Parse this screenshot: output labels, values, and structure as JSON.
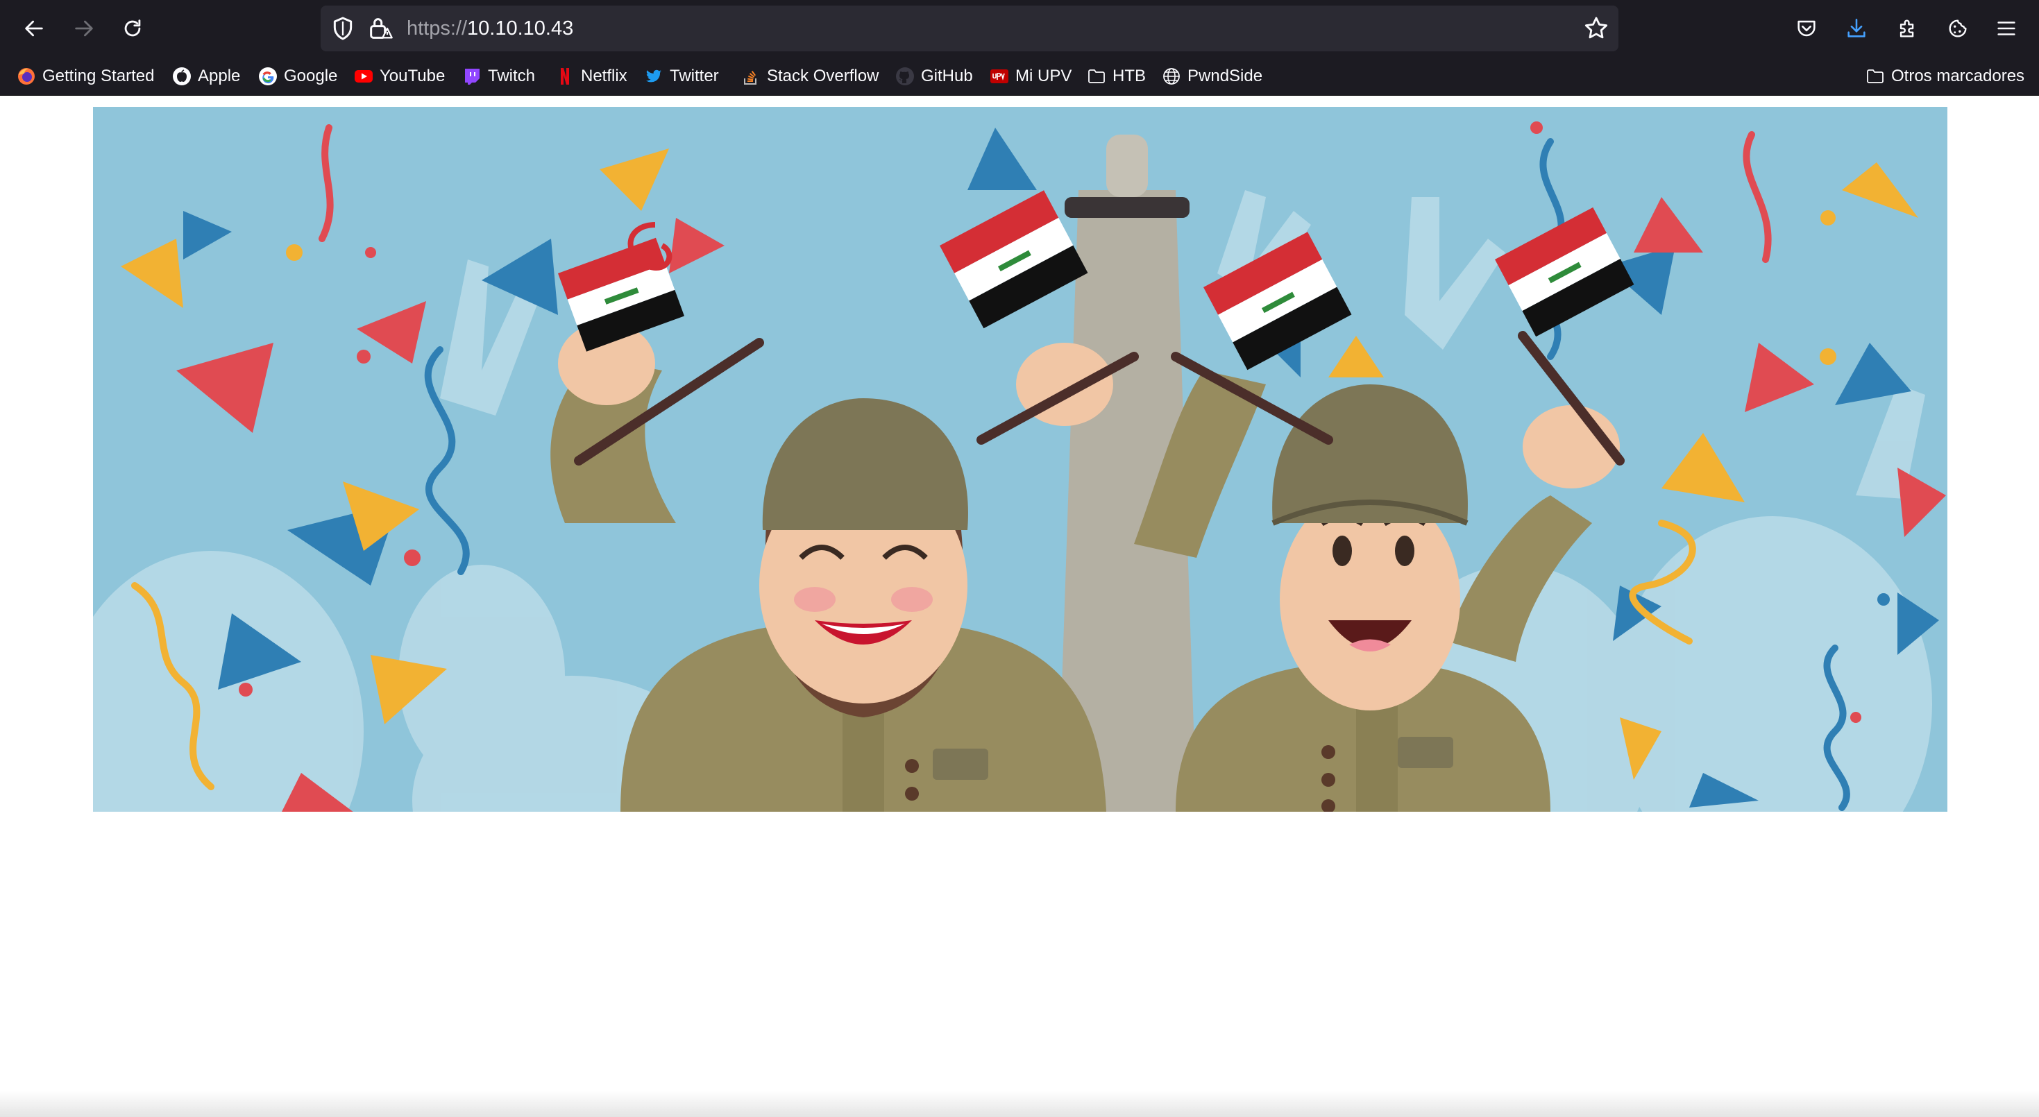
{
  "browser": {
    "url_scheme": "https://",
    "url_host": "10.10.10.43",
    "accent_color": "#1c1b22",
    "icons": {
      "back": "arrow-left-icon",
      "forward": "arrow-right-icon",
      "reload": "reload-icon",
      "tracking_protection": "shield-icon",
      "connection": "lock-warning-icon",
      "bookmark_page": "star-icon",
      "pocket": "pocket-icon",
      "downloads": "download-icon",
      "extensions": "puzzle-icon",
      "cookies": "cookie-icon",
      "menu": "hamburger-menu-icon"
    }
  },
  "bookmarks": [
    {
      "label": "Getting Started",
      "icon": "firefox-icon"
    },
    {
      "label": "Apple",
      "icon": "apple-icon"
    },
    {
      "label": "Google",
      "icon": "google-icon"
    },
    {
      "label": "YouTube",
      "icon": "youtube-icon"
    },
    {
      "label": "Twitch",
      "icon": "twitch-icon"
    },
    {
      "label": "Netflix",
      "icon": "netflix-icon"
    },
    {
      "label": "Twitter",
      "icon": "twitter-icon"
    },
    {
      "label": "Stack Overflow",
      "icon": "stackoverflow-icon"
    },
    {
      "label": "GitHub",
      "icon": "github-icon"
    },
    {
      "label": "Mi UPV",
      "icon": "upv-icon"
    },
    {
      "label": "HTB",
      "icon": "folder-icon"
    },
    {
      "label": "PwndSide",
      "icon": "globe-icon"
    }
  ],
  "other_bookmarks": {
    "label": "Otros marcadores",
    "icon": "folder-icon"
  },
  "page": {
    "hero_image": "celebration-illustration",
    "hero_colors": {
      "sky": "#8fc5da",
      "helmet": "#7d7656",
      "uniform": "#978c5f"
    }
  }
}
